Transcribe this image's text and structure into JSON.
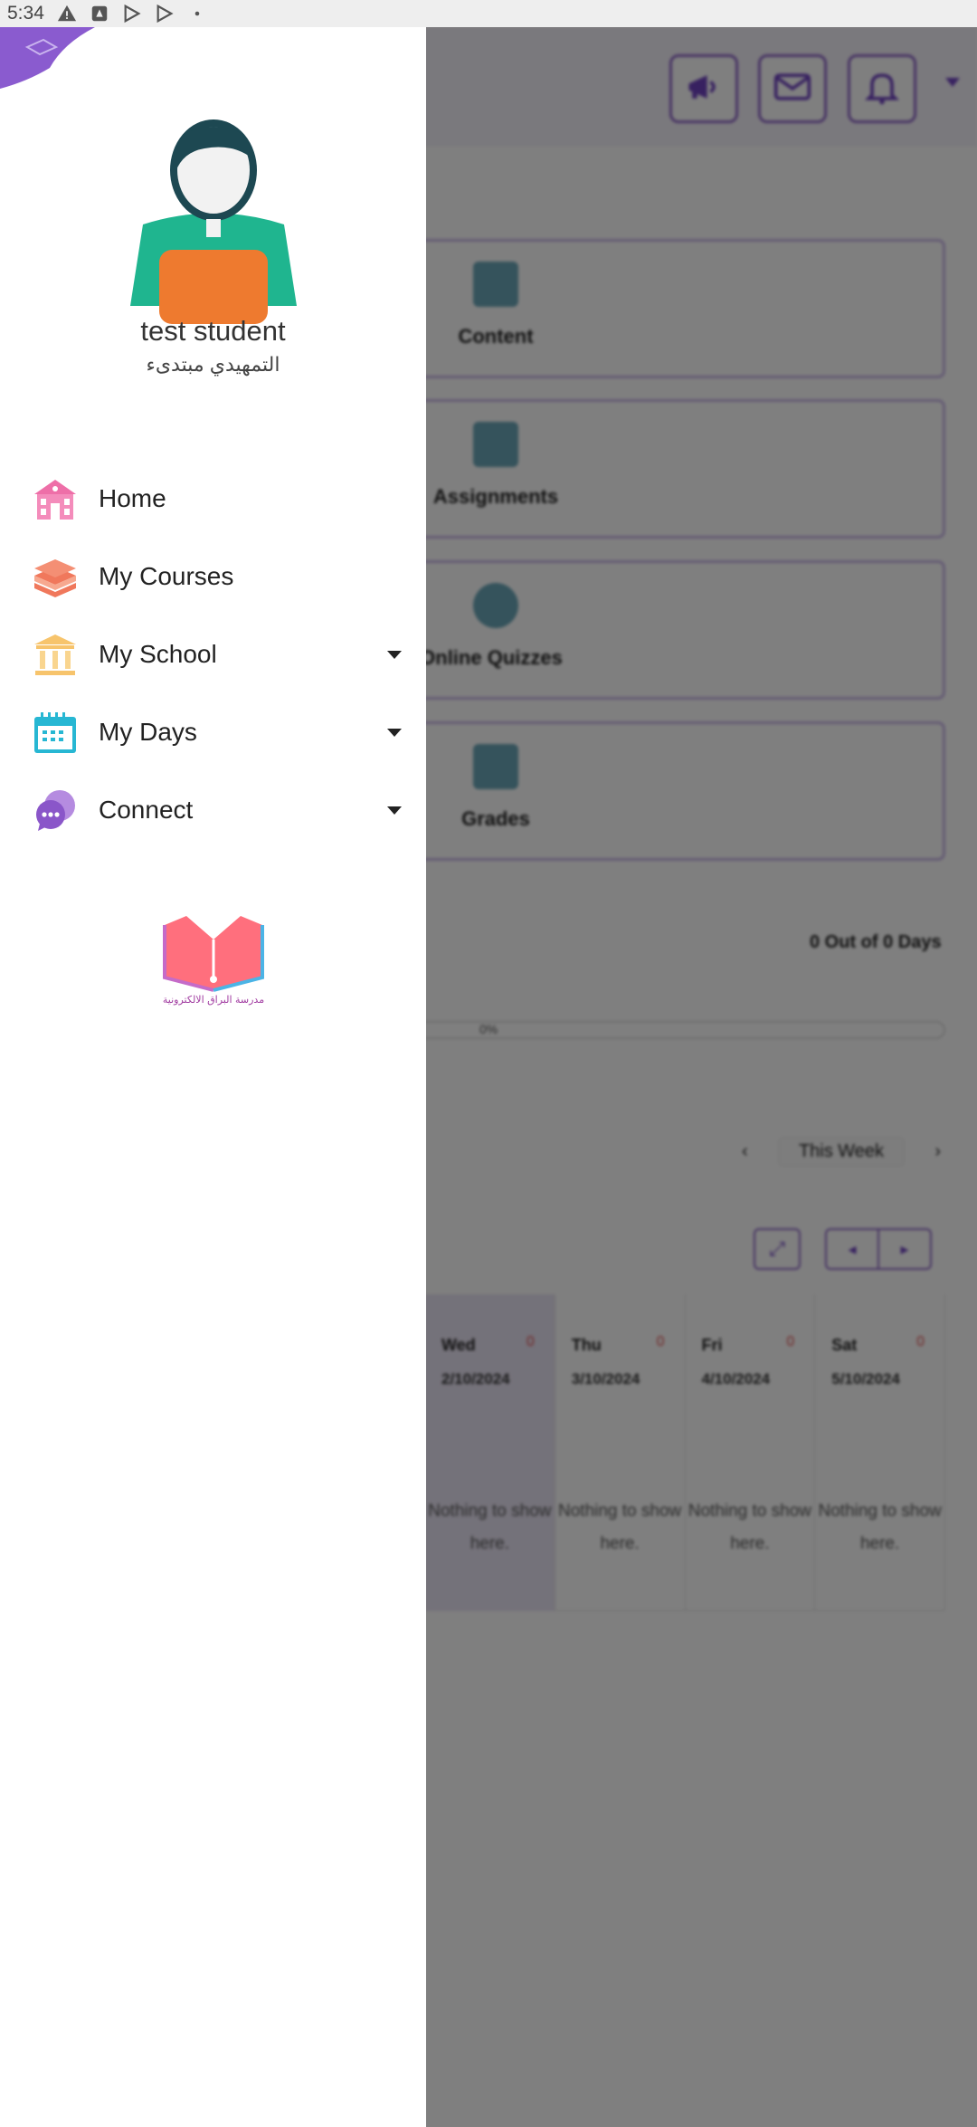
{
  "status_bar": {
    "time": "5:34"
  },
  "drawer": {
    "user": {
      "name": "test student",
      "subtitle": "التمهيدي مبتدىء"
    },
    "menu": [
      {
        "label": "Home",
        "icon": "school-building-icon",
        "has_submenu": false
      },
      {
        "label": "My Courses",
        "icon": "books-stack-icon",
        "has_submenu": false
      },
      {
        "label": "My School",
        "icon": "institution-columns-icon",
        "has_submenu": true
      },
      {
        "label": "My Days",
        "icon": "calendar-icon",
        "has_submenu": true
      },
      {
        "label": "Connect",
        "icon": "chat-bubbles-icon",
        "has_submenu": true
      }
    ],
    "logo_text": "مدرسة البراق الالكترونية"
  },
  "background": {
    "tiles": [
      "Content",
      "Assignments",
      "Online Quizzes",
      "Grades"
    ],
    "days_progress": "0 Out of 0 Days",
    "progress_pct": "0%",
    "week_label": "This Week",
    "calendar": [
      {
        "day": "Wed",
        "date": "2/10/2024",
        "count": "0",
        "empty": "Nothing to show here."
      },
      {
        "day": "Thu",
        "date": "3/10/2024",
        "count": "0",
        "empty": "Nothing to show here."
      },
      {
        "day": "Fri",
        "date": "4/10/2024",
        "count": "0",
        "empty": "Nothing to show here."
      },
      {
        "day": "Sat",
        "date": "5/10/2024",
        "count": "0",
        "empty": "Nothing to show here."
      }
    ]
  },
  "colors": {
    "accent": "#6f42c1",
    "overlay": "rgba(0,0,0,0.5)",
    "home_icon": "#ee6fa8",
    "courses_icon": "#f0785c",
    "school_icon": "#f7c46c",
    "days_icon": "#27b7d3",
    "connect_icon": "#8a56c9"
  }
}
